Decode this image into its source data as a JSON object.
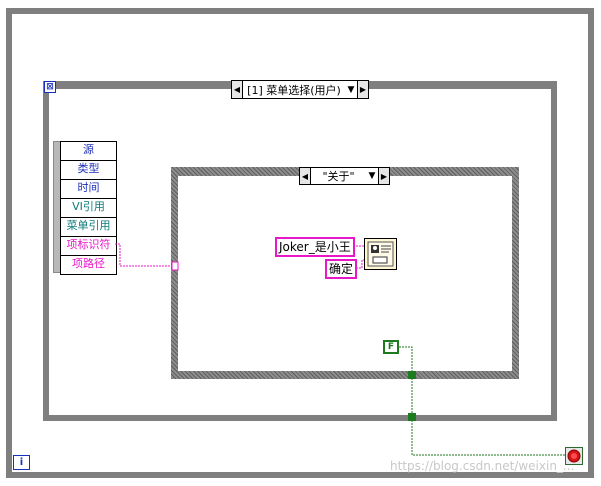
{
  "event_structure": {
    "selector_label": "[1] 菜单选择(用户)",
    "timeout_terminal": "⊠"
  },
  "event_data_node": {
    "items": [
      "源",
      "类型",
      "时间",
      "VI引用",
      "菜单引用",
      "项标识符",
      "项路径"
    ],
    "colors": {
      "default": "#1f2fb8",
      "ref": "#0c7a7a",
      "string": "#e817c8"
    }
  },
  "case_structure": {
    "selector_label": "\"关于\""
  },
  "constants": {
    "message": "Joker_是小王",
    "button": "确定",
    "boolean": "F"
  },
  "terminals": {
    "iteration": "i"
  },
  "watermark": "https://blog.csdn.net/weixin_..."
}
